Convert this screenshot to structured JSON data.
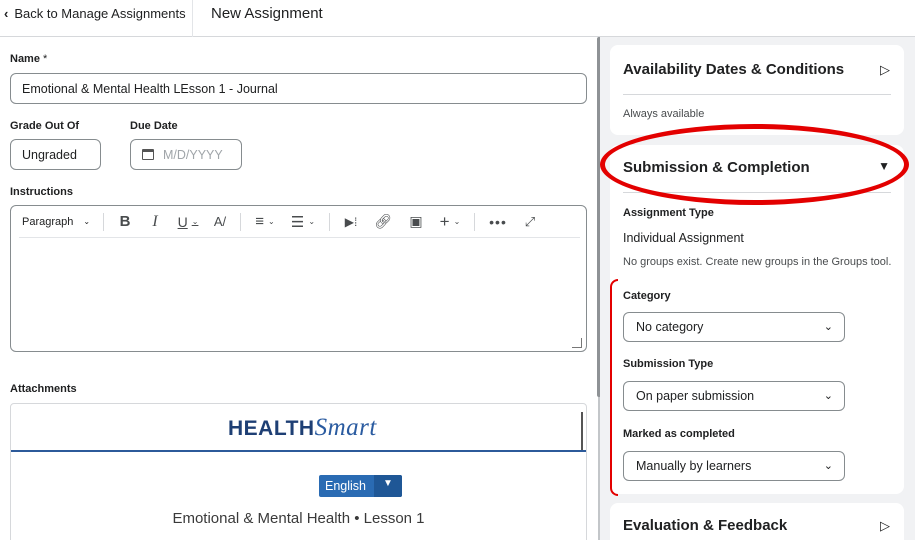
{
  "topbar": {
    "back_label": "Back to Manage Assignments",
    "title": "New Assignment"
  },
  "form": {
    "name_label": "Name",
    "required_mark": "*",
    "name_value": "Emotional & Mental Health LEsson 1 - Journal",
    "grade_label": "Grade Out Of",
    "grade_value": "Ungraded",
    "due_label": "Due Date",
    "due_placeholder": "M/D/YYYY",
    "instructions_label": "Instructions",
    "paragraph_label": "Paragraph",
    "attachments_label": "Attachments"
  },
  "attachment": {
    "logo_part1": "HEALTH",
    "logo_part2": "Smart",
    "language_button": "English",
    "language_arrow": "▼",
    "lesson_title": "Emotional & Mental Health • Lesson 1"
  },
  "panel": {
    "availability": {
      "title": "Availability Dates & Conditions",
      "status": "Always available",
      "arrow": "▷"
    },
    "submission": {
      "title": "Submission & Completion",
      "assignment_type_label": "Assignment Type",
      "assignment_type_value": "Individual Assignment",
      "groups_note": "No groups exist. Create new groups in the Groups tool.",
      "category_label": "Category",
      "category_value": "No category",
      "submission_type_label": "Submission Type",
      "submission_type_value": "On paper submission",
      "completed_label": "Marked as completed",
      "completed_value": "Manually by learners"
    },
    "evaluation": {
      "title": "Evaluation & Feedback",
      "arrow": "▷"
    }
  },
  "colors": {
    "highlight": "#e30000",
    "panel_bg": "#f1f2f4",
    "accent": "#2a6bb3"
  }
}
